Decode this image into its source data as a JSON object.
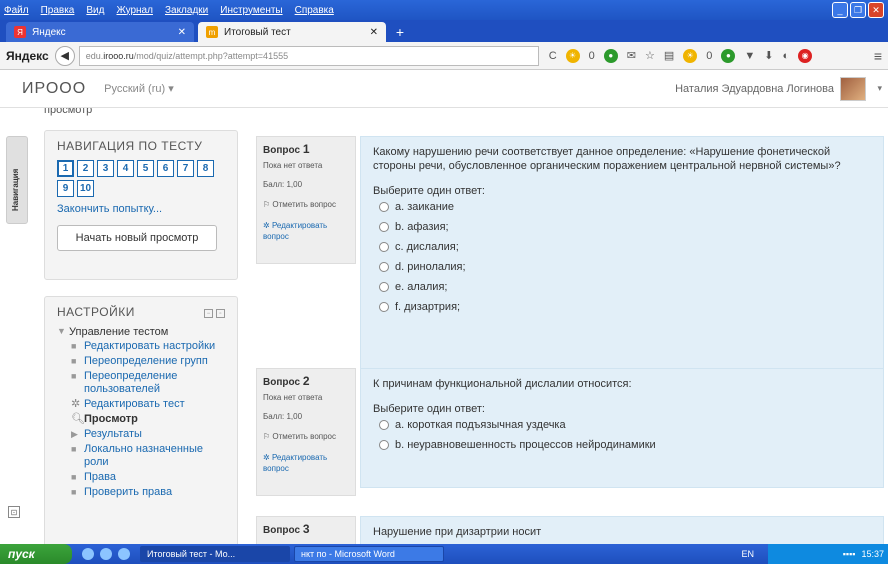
{
  "menubar": [
    "Файл",
    "Правка",
    "Вид",
    "Журнал",
    "Закладки",
    "Инструменты",
    "Справка"
  ],
  "tabs": [
    {
      "label": "Яндекс",
      "icon": "Я",
      "active": false
    },
    {
      "label": "Итоговый тест",
      "icon": "m",
      "active": true
    }
  ],
  "browser": {
    "brand": "Яндекс",
    "url_prefix": "edu.",
    "url_host": "irooo.ru",
    "url_path": "/mod/quiz/attempt.php?attempt=41555",
    "counter1": "0",
    "counter2": "0"
  },
  "header": {
    "site_name": "ИРООО",
    "language": "Русский (ru) ▾",
    "user_name": "Наталия Эдуардовна Логинова"
  },
  "breadcrumb_cut": "просмотр",
  "dock_label": "Навигация",
  "nav_block": {
    "title": "НАВИГАЦИЯ ПО ТЕСТУ",
    "questions": [
      "1",
      "2",
      "3",
      "4",
      "5",
      "6",
      "7",
      "8",
      "9",
      "10"
    ],
    "finish_link": "Закончить попытку...",
    "new_view_button": "Начать новый просмотр"
  },
  "settings_block": {
    "title": "НАСТРОЙКИ",
    "root": "Управление тестом",
    "items": [
      {
        "label": "Редактировать настройки",
        "type": "link"
      },
      {
        "label": "Переопределение групп",
        "type": "link"
      },
      {
        "label": "Переопределение пользователей",
        "type": "link"
      },
      {
        "label": "Редактировать тест",
        "type": "gear"
      },
      {
        "label": "Просмотр",
        "type": "current"
      },
      {
        "label": "Результаты",
        "type": "expand"
      },
      {
        "label": "Локально назначенные роли",
        "type": "link"
      },
      {
        "label": "Права",
        "type": "link"
      },
      {
        "label": "Проверить права",
        "type": "link"
      }
    ]
  },
  "questions": [
    {
      "label": "Вопрос",
      "number": "1",
      "status": "Пока нет ответа",
      "score": "Балл: 1,00",
      "flag": "Отметить вопрос",
      "edit": "Редактировать вопрос",
      "text": "Какому нарушению речи соответствует данное определение: «Нарушение фонетической стороны речи, обусловленное органическим поражением центральной нервной системы»?",
      "prompt": "Выберите один ответ:",
      "options": [
        "a. заикание",
        "b. афазия;",
        "c. дислалия;",
        "d. ринолалия;",
        "e. алалия;",
        "f. дизартрия;"
      ]
    },
    {
      "label": "Вопрос",
      "number": "2",
      "status": "Пока нет ответа",
      "score": "Балл: 1,00",
      "flag": "Отметить вопрос",
      "edit": "Редактировать вопрос",
      "text": "К причинам функциональной дислалии относится:",
      "prompt": "Выберите один ответ:",
      "options": [
        "a. короткая подъязычная уздечка",
        "b. неуравновешенность процессов нейродинамики"
      ]
    },
    {
      "label": "Вопрос",
      "number": "3",
      "text": "Нарушение при дизартрии носит"
    }
  ],
  "taskbar": {
    "start": "пуск",
    "tasks": [
      "Итоговый тест - Мо...",
      "нкт по - Microsoft Word"
    ],
    "lang": "EN",
    "time": "15:37"
  }
}
